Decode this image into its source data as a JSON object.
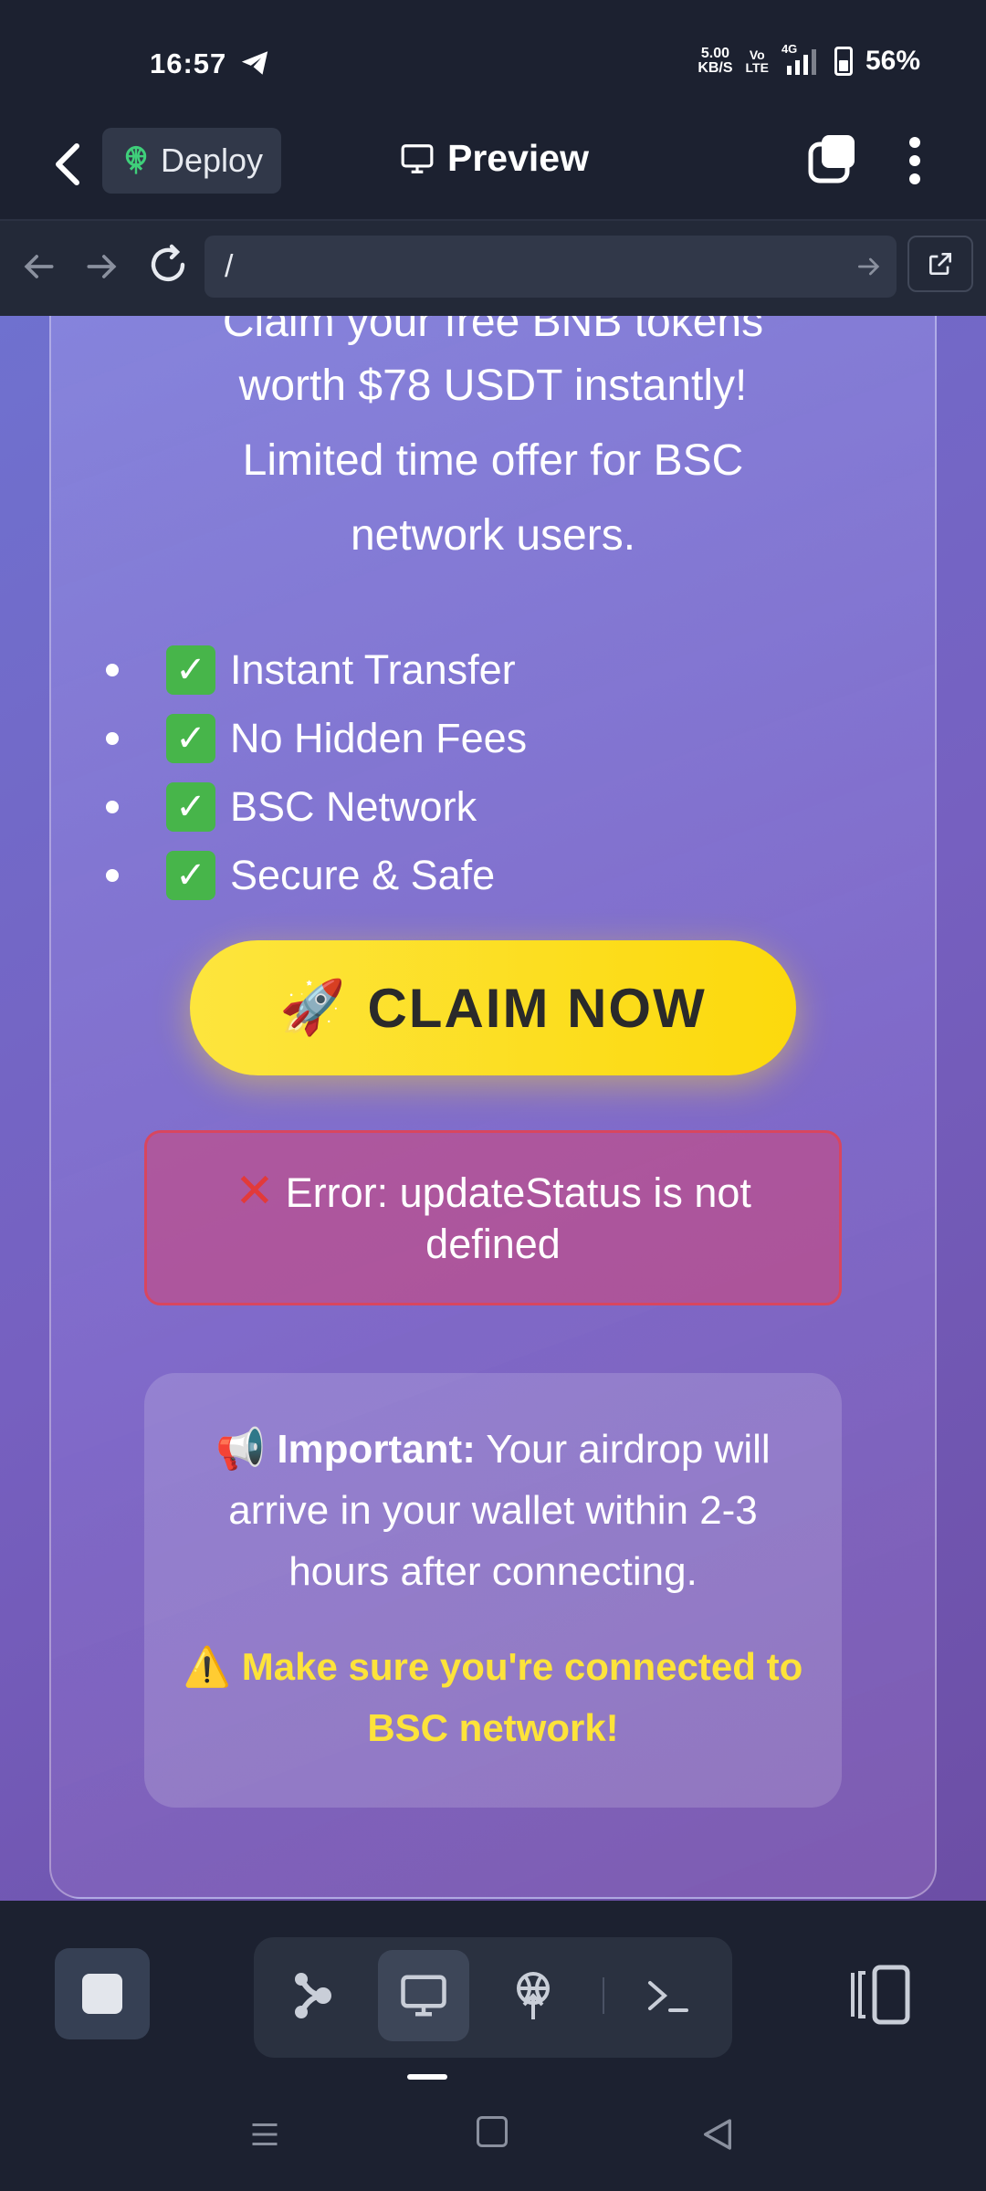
{
  "status_bar": {
    "time": "16:57",
    "net_speed_value": "5.00",
    "net_speed_unit": "KB/S",
    "volte_top": "Vo",
    "volte_bottom": "LTE",
    "network_type": "4G",
    "battery": "56%"
  },
  "header": {
    "deploy_label": "Deploy",
    "preview_label": "Preview"
  },
  "browser": {
    "url": "/"
  },
  "content": {
    "description_partial": "Claim your free BNB tokens",
    "description_lines": [
      "worth $78 USDT instantly!",
      "Limited time offer for BSC",
      "network users."
    ],
    "features": [
      "Instant Transfer",
      "No Hidden Fees",
      "BSC Network",
      "Secure & Safe"
    ],
    "claim_button": "CLAIM NOW",
    "error_line1": "Error: updateStatus is not",
    "error_line2": "defined",
    "info_bold": "Important:",
    "info_text": " Your airdrop will arrive in your wallet within 2-3 hours after connecting.",
    "warning_text": "Make sure you're connected to BSC network!"
  },
  "colors": {
    "background": "#1c2130",
    "accent_yellow": "#fde33a",
    "error_border": "#d8465f",
    "check_green": "#47b54a"
  }
}
